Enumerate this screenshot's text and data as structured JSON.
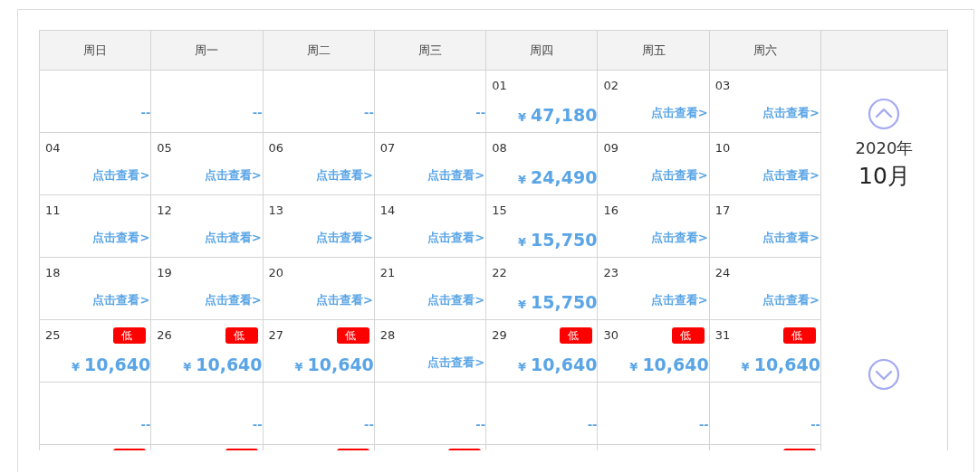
{
  "weekdays": [
    "周日",
    "周一",
    "周二",
    "周三",
    "周四",
    "周五",
    "周六"
  ],
  "weeks": [
    [
      {
        "kind": "blank",
        "value": "--"
      },
      {
        "kind": "blank",
        "value": "--"
      },
      {
        "kind": "blank",
        "value": "--"
      },
      {
        "kind": "blank",
        "value": "--"
      },
      {
        "kind": "price",
        "date": "01",
        "currency": "¥",
        "amount": "47,180",
        "low": false
      },
      {
        "kind": "link",
        "date": "02",
        "link": "点击查看>"
      },
      {
        "kind": "link",
        "date": "03",
        "link": "点击查看>"
      }
    ],
    [
      {
        "kind": "link",
        "date": "04",
        "link": "点击查看>"
      },
      {
        "kind": "link",
        "date": "05",
        "link": "点击查看>"
      },
      {
        "kind": "link",
        "date": "06",
        "link": "点击查看>"
      },
      {
        "kind": "link",
        "date": "07",
        "link": "点击查看>"
      },
      {
        "kind": "price",
        "date": "08",
        "currency": "¥",
        "amount": "24,490",
        "low": false
      },
      {
        "kind": "link",
        "date": "09",
        "link": "点击查看>"
      },
      {
        "kind": "link",
        "date": "10",
        "link": "点击查看>"
      }
    ],
    [
      {
        "kind": "link",
        "date": "11",
        "link": "点击查看>"
      },
      {
        "kind": "link",
        "date": "12",
        "link": "点击查看>"
      },
      {
        "kind": "link",
        "date": "13",
        "link": "点击查看>"
      },
      {
        "kind": "link",
        "date": "14",
        "link": "点击查看>"
      },
      {
        "kind": "price",
        "date": "15",
        "currency": "¥",
        "amount": "15,750",
        "low": false
      },
      {
        "kind": "link",
        "date": "16",
        "link": "点击查看>"
      },
      {
        "kind": "link",
        "date": "17",
        "link": "点击查看>"
      }
    ],
    [
      {
        "kind": "link",
        "date": "18",
        "link": "点击查看>"
      },
      {
        "kind": "link",
        "date": "19",
        "link": "点击查看>"
      },
      {
        "kind": "link",
        "date": "20",
        "link": "点击查看>"
      },
      {
        "kind": "link",
        "date": "21",
        "link": "点击查看>"
      },
      {
        "kind": "price",
        "date": "22",
        "currency": "¥",
        "amount": "15,750",
        "low": false
      },
      {
        "kind": "link",
        "date": "23",
        "link": "点击查看>"
      },
      {
        "kind": "link",
        "date": "24",
        "link": "点击查看>"
      }
    ],
    [
      {
        "kind": "price",
        "date": "25",
        "currency": "¥",
        "amount": "10,640",
        "low": true,
        "badge": "低"
      },
      {
        "kind": "price",
        "date": "26",
        "currency": "¥",
        "amount": "10,640",
        "low": true,
        "badge": "低"
      },
      {
        "kind": "price",
        "date": "27",
        "currency": "¥",
        "amount": "10,640",
        "low": true,
        "badge": "低"
      },
      {
        "kind": "link",
        "date": "28",
        "link": "点击查看>"
      },
      {
        "kind": "price",
        "date": "29",
        "currency": "¥",
        "amount": "10,640",
        "low": true,
        "badge": "低"
      },
      {
        "kind": "price",
        "date": "30",
        "currency": "¥",
        "amount": "10,640",
        "low": true,
        "badge": "低"
      },
      {
        "kind": "price",
        "date": "31",
        "currency": "¥",
        "amount": "10,640",
        "low": true,
        "badge": "低"
      }
    ],
    [
      {
        "kind": "blank",
        "value": "--"
      },
      {
        "kind": "blank",
        "value": "--"
      },
      {
        "kind": "blank",
        "value": "--"
      },
      {
        "kind": "blank",
        "value": "--"
      },
      {
        "kind": "blank",
        "value": "--"
      },
      {
        "kind": "blank",
        "value": "--"
      },
      {
        "kind": "blank",
        "value": "--"
      }
    ],
    [
      {
        "kind": "cut",
        "low": true
      },
      {
        "kind": "cut",
        "low": true
      },
      {
        "kind": "cut",
        "low": true
      },
      {
        "kind": "cut",
        "low": true
      },
      {
        "kind": "cut",
        "low": false
      },
      {
        "kind": "cut",
        "low": false
      },
      {
        "kind": "cut",
        "low": true
      }
    ]
  ],
  "month_panel": {
    "year": "2020年",
    "month": "10月"
  }
}
